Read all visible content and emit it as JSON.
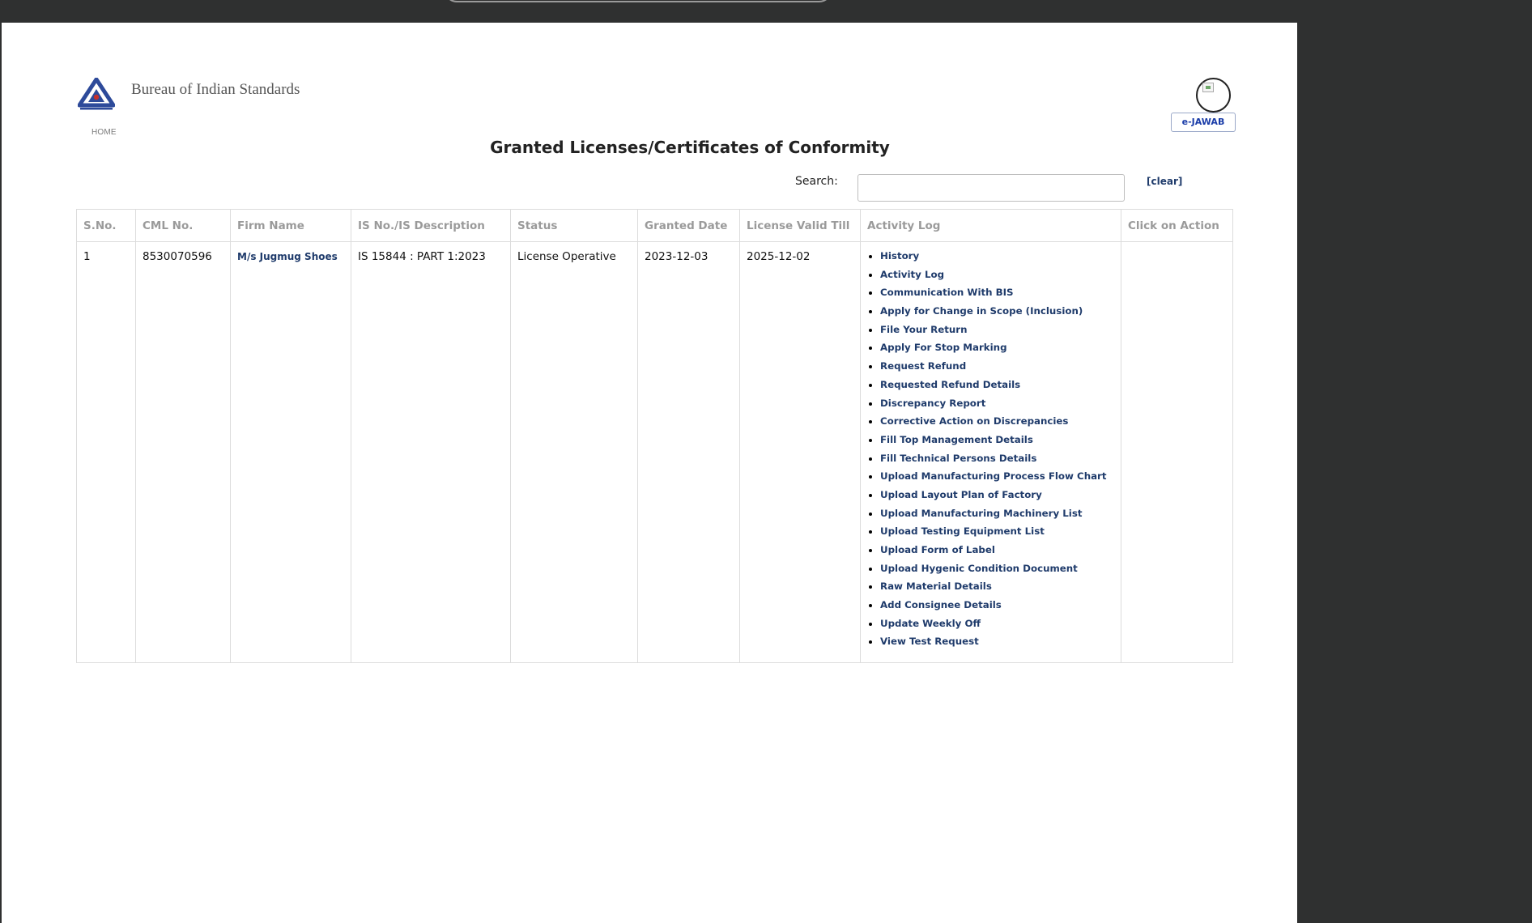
{
  "header": {
    "org_name": "Bureau of Indian Standards",
    "home_label": "HOME",
    "ejawab_label": "e-JAWAB"
  },
  "page": {
    "title": "Granted Licenses/Certificates of Conformity"
  },
  "search": {
    "label": "Search:",
    "value": "",
    "clear_label": "[clear]"
  },
  "table": {
    "headers": [
      "S.No.",
      "CML No.",
      "Firm Name",
      "IS No./IS Description",
      "Status",
      "Granted Date",
      "License Valid Till",
      "Activity Log",
      "Click on Action"
    ],
    "rows": [
      {
        "sno": "1",
        "cml_no": "8530070596",
        "firm_name": "M/s Jugmug Shoes",
        "is_description": "IS 15844 : PART 1:2023",
        "status": "License Operative",
        "granted_date": "2023-12-03",
        "valid_till": "2025-12-02",
        "activity_links": [
          "History",
          "Activity Log",
          "Communication With BIS",
          "Apply for Change in Scope (Inclusion)",
          "File Your Return",
          "Apply For Stop Marking",
          "Request Refund",
          "Requested Refund Details",
          "Discrepancy Report",
          "Corrective Action on Discrepancies",
          "Fill Top Management Details",
          "Fill Technical Persons Details",
          "Upload Manufacturing Process Flow Chart",
          "Upload Layout Plan of Factory",
          "Upload Manufacturing Machinery List",
          "Upload Testing Equipment List",
          "Upload Form of Label",
          "Upload Hygenic Condition Document",
          "Raw Material Details",
          "Add Consignee Details",
          "Update Weekly Off",
          "View Test Request"
        ],
        "click_on_action": ""
      }
    ]
  },
  "colors": {
    "link": "#1f3b6b",
    "header_text": "#9a9a9a",
    "logo_blue": "#2d4a9a",
    "logo_red": "#c8302a",
    "chrome": "#2f3030"
  }
}
